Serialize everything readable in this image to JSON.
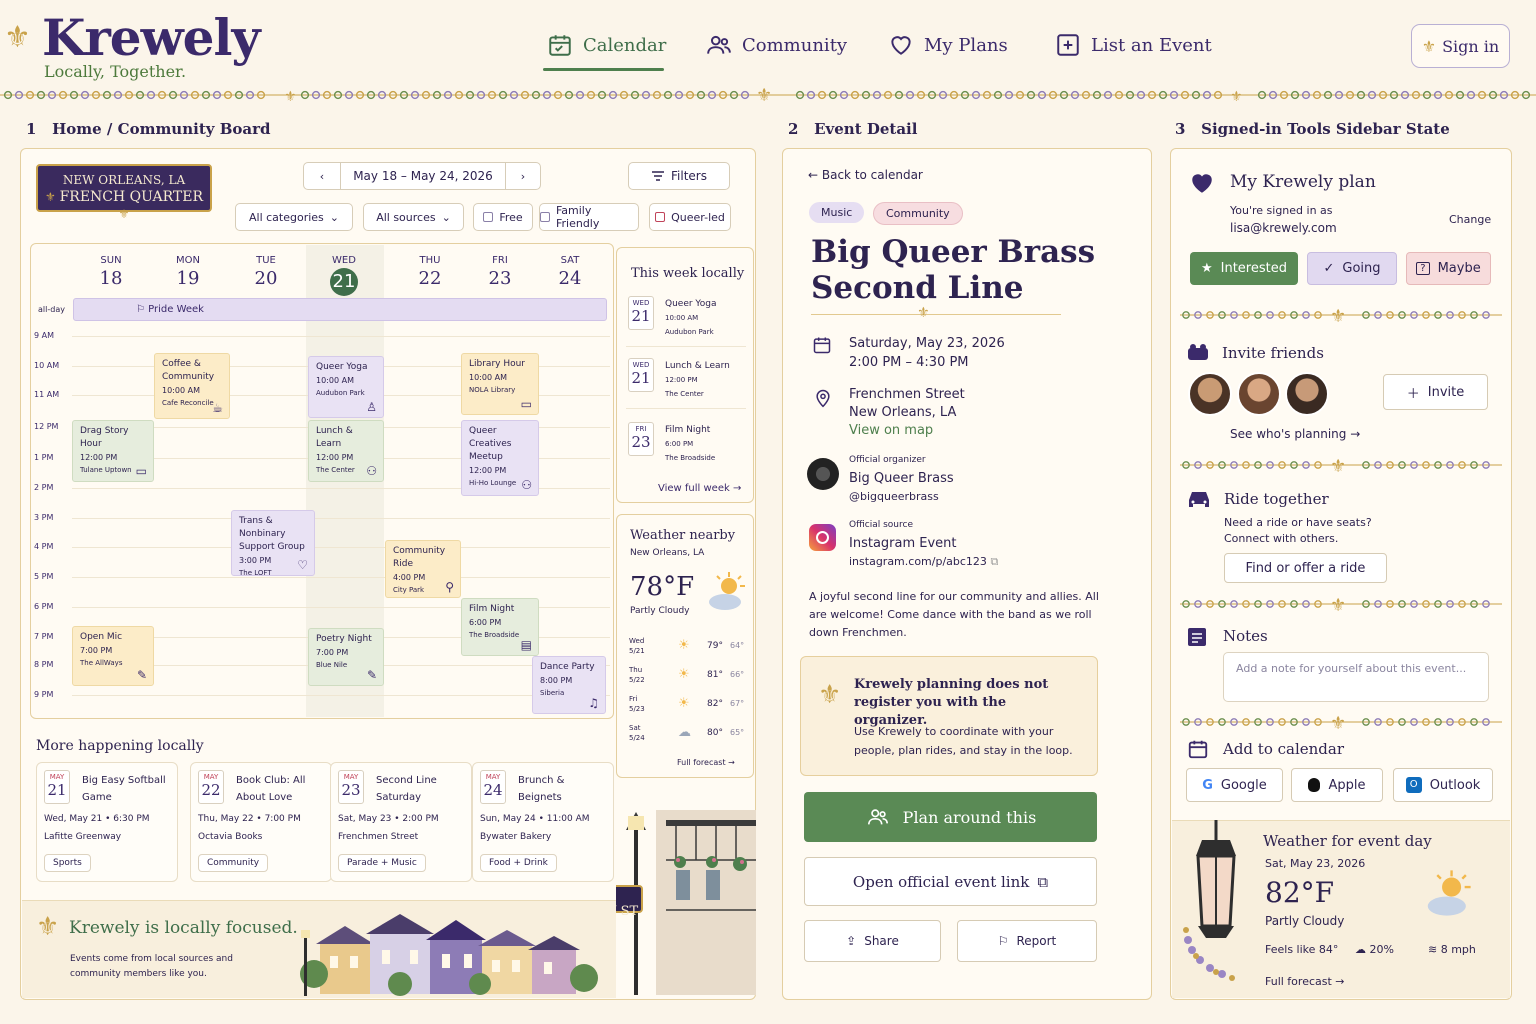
{
  "brand": {
    "name": "Krewely",
    "tagline": "Locally, Together."
  },
  "nav": {
    "items": [
      {
        "label": "Calendar",
        "icon": "calendar-icon",
        "active": true
      },
      {
        "label": "Community",
        "icon": "people-icon"
      },
      {
        "label": "My Plans",
        "icon": "heart-icon"
      },
      {
        "label": "List an Event",
        "icon": "plus-square-icon"
      }
    ],
    "signin": "Sign in"
  },
  "sections": {
    "left": {
      "num": "1",
      "title": "Home / Community Board"
    },
    "mid": {
      "num": "2",
      "title": "Event Detail"
    },
    "right": {
      "num": "3",
      "title": "Signed-in Tools Sidebar State"
    }
  },
  "location": {
    "line1": "NEW ORLEANS, LA",
    "line2": "FRENCH QUARTER"
  },
  "toolbar": {
    "date_range": "May 18 – May 24, 2026",
    "filters": "Filters",
    "categories": "All categories",
    "sources": "All sources",
    "free": "Free",
    "family": "Family Friendly",
    "queer": "Queer-led"
  },
  "calendar": {
    "days": [
      {
        "dow": "SUN",
        "num": "18"
      },
      {
        "dow": "MON",
        "num": "19"
      },
      {
        "dow": "TUE",
        "num": "20"
      },
      {
        "dow": "WED",
        "num": "21"
      },
      {
        "dow": "THU",
        "num": "22"
      },
      {
        "dow": "FRI",
        "num": "23"
      },
      {
        "dow": "SAT",
        "num": "24"
      }
    ],
    "allday_label": "all-day",
    "allday_event": "Pride Week",
    "hours": [
      "9 AM",
      "10 AM",
      "11 AM",
      "12 PM",
      "1 PM",
      "2 PM",
      "3 PM",
      "4 PM",
      "5 PM",
      "6 PM",
      "7 PM",
      "8 PM",
      "9 PM"
    ],
    "events": [
      {
        "title": "Coffee & Community",
        "time": "10:00 AM",
        "place": "Cafe Reconcile"
      },
      {
        "title": "Queer Yoga",
        "time": "10:00 AM",
        "place": "Audubon Park"
      },
      {
        "title": "Library Hour",
        "time": "10:00 AM",
        "place": "NOLA Library"
      },
      {
        "title": "Drag Story Hour",
        "time": "12:00 PM",
        "place": "Tulane Uptown"
      },
      {
        "title": "Lunch & Learn",
        "time": "12:00 PM",
        "place": "The Center"
      },
      {
        "title": "Queer Creatives Meetup",
        "time": "12:00 PM",
        "place": "Hi-Ho Lounge"
      },
      {
        "title": "Trans & Nonbinary Support Group",
        "time": "3:00 PM",
        "place": "The LOFT"
      },
      {
        "title": "Community Ride",
        "time": "4:00 PM",
        "place": "City Park"
      },
      {
        "title": "Film Night",
        "time": "6:00 PM",
        "place": "The Broadside"
      },
      {
        "title": "Open Mic",
        "time": "7:00 PM",
        "place": "The AllWays"
      },
      {
        "title": "Poetry Night",
        "time": "7:00 PM",
        "place": "Blue Nile"
      },
      {
        "title": "Dance Party",
        "time": "8:00 PM",
        "place": "Siberia"
      }
    ]
  },
  "this_week": {
    "title": "This week locally",
    "items": [
      {
        "dow": "WED",
        "num": "21",
        "title": "Queer Yoga",
        "time": "10:00 AM",
        "place": "Audubon Park"
      },
      {
        "dow": "WED",
        "num": "21",
        "title": "Lunch & Learn",
        "time": "12:00 PM",
        "place": "The Center"
      },
      {
        "dow": "FRI",
        "num": "23",
        "title": "Film Night",
        "time": "6:00 PM",
        "place": "The Broadside"
      }
    ],
    "link": "View full week"
  },
  "weather_left": {
    "title": "Weather nearby",
    "loc": "New Orleans, LA",
    "temp": "78°F",
    "cond": "Partly Cloudy",
    "days": [
      {
        "d": "Wed",
        "date": "5/21",
        "hi": "79°",
        "lo": "64°"
      },
      {
        "d": "Thu",
        "date": "5/22",
        "hi": "81°",
        "lo": "66°"
      },
      {
        "d": "Fri",
        "date": "5/23",
        "hi": "82°",
        "lo": "67°"
      },
      {
        "d": "Sat",
        "date": "5/24",
        "hi": "80°",
        "lo": "65°"
      }
    ],
    "link": "Full forecast"
  },
  "more": {
    "title": "More happening locally",
    "cards": [
      {
        "mon": "MAY",
        "num": "21",
        "title": "Big Easy Softball Game",
        "when": "Wed, May 21 • 6:30 PM",
        "where": "Lafitte Greenway",
        "tag": "Sports"
      },
      {
        "mon": "MAY",
        "num": "22",
        "title": "Book Club: All About Love",
        "when": "Thu, May 22 • 7:00 PM",
        "where": "Octavia Books",
        "tag": "Community"
      },
      {
        "mon": "MAY",
        "num": "23",
        "title": "Second Line Saturday",
        "when": "Sat, May 23 • 2:00 PM",
        "where": "Frenchmen Street",
        "tag": "Parade + Music"
      },
      {
        "mon": "MAY",
        "num": "24",
        "title": "Brunch & Beignets",
        "when": "Sun, May 24 • 11:00 AM",
        "where": "Bywater Bakery",
        "tag": "Food + Drink"
      }
    ]
  },
  "banner": {
    "title": "Krewely is locally focused.",
    "text": "Events come from local sources and community members like you.",
    "sign": "JOY ST"
  },
  "detail": {
    "back": "Back to calendar",
    "tags": [
      "Music",
      "Community"
    ],
    "title_l1": "Big Queer Brass",
    "title_l2": "Second Line",
    "date": "Saturday, May 23, 2026",
    "time": "2:00 PM – 4:30 PM",
    "place1": "Frenchmen Street",
    "place2": "New Orleans, LA",
    "map": "View on map",
    "org_label": "Official organizer",
    "org_name": "Big Queer Brass",
    "org_handle": "@bigqueerbrass",
    "src_label": "Official source",
    "src_name": "Instagram Event",
    "src_url": "instagram.com/p/abc123",
    "desc": "A joyful second line for our community and allies. All are welcome! Come dance with the band as we roll down Frenchmen.",
    "note_title": "Krewely planning does not register you with the organizer.",
    "note_text": "Use Krewely to coordinate with your people, plan rides, and stay in the loop.",
    "plan": "Plan around this",
    "open": "Open official event link",
    "share": "Share",
    "report": "Report"
  },
  "sidebar": {
    "plan_title": "My Krewely plan",
    "signed": "You're signed in as",
    "email": "lisa@krewely.com",
    "change": "Change",
    "interested": "Interested",
    "going": "Going",
    "maybe": "Maybe",
    "invite_title": "Invite friends",
    "invite": "Invite",
    "see": "See who's planning",
    "ride_title": "Ride together",
    "ride_text1": "Need a ride or have seats?",
    "ride_text2": "Connect with others.",
    "ride_btn": "Find or offer a ride",
    "notes_title": "Notes",
    "notes_ph": "Add a note for yourself about this event...",
    "cal_title": "Add to calendar",
    "google": "Google",
    "apple": "Apple",
    "outlook": "Outlook",
    "w_title": "Weather for event day",
    "w_date": "Sat, May 23, 2026",
    "w_temp": "82°F",
    "w_cond": "Partly Cloudy",
    "w_feels": "Feels like 84°",
    "w_rain": "20%",
    "w_wind": "8 mph",
    "w_link": "Full forecast"
  },
  "colors": {
    "accent": "#3f6e4a",
    "brand": "#3b2a6b",
    "gold": "#c9a24a"
  }
}
